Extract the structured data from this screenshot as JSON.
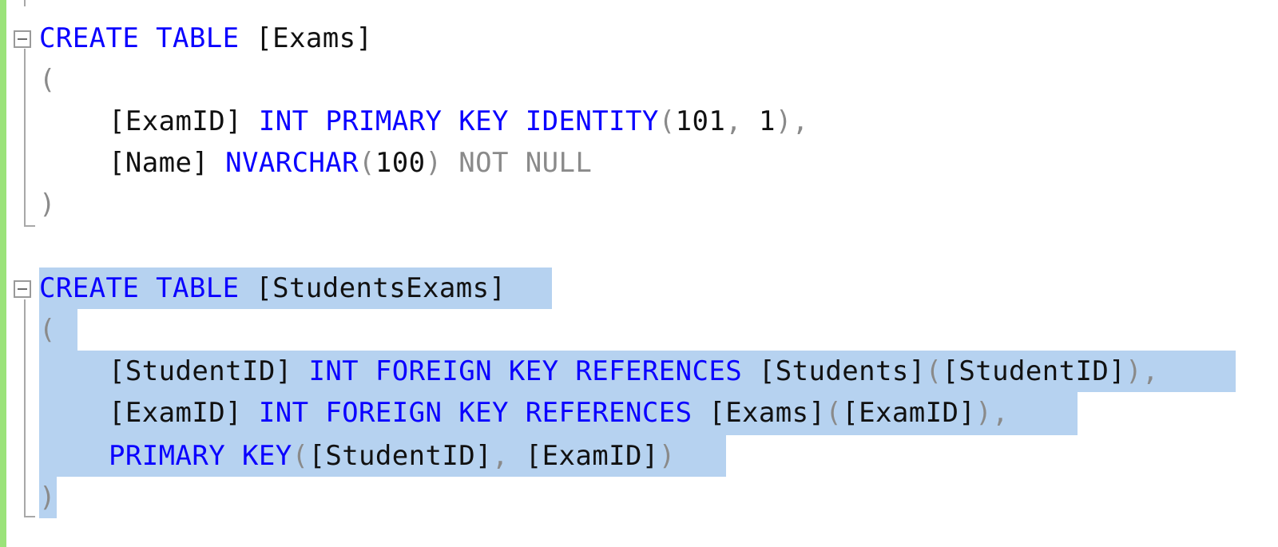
{
  "colors": {
    "keyword": "#0a00ff",
    "operator": "#8a8a8a",
    "text": "#111111",
    "selection": "#b6d2f0",
    "change_bar": "#9be37a"
  },
  "icons": {
    "fold": "collapse-minus-icon"
  },
  "code": {
    "l1": {
      "t1": "CREATE TABLE",
      "t2": " [Exams]"
    },
    "l2": {
      "t1": "("
    },
    "l3": {
      "t1": "[ExamID]",
      "t2": " INT PRIMARY KEY IDENTITY",
      "t3": "(",
      "t4": "101",
      "t5": ", ",
      "t6": "1",
      "t7": "),"
    },
    "l4": {
      "t1": "[Name]",
      "t2": " NVARCHAR",
      "t3": "(",
      "t4": "100",
      "t5": ") NOT NULL"
    },
    "l5": {
      "t1": ")"
    },
    "l6": {
      "t1": "CREATE TABLE",
      "t2": " [StudentsExams]"
    },
    "l7": {
      "t1": "("
    },
    "l8": {
      "t1": "[StudentID]",
      "t2": " INT FOREIGN KEY REFERENCES",
      "t3": " [Students]",
      "t4": "(",
      "t5": "[StudentID]",
      "t6": "),"
    },
    "l9": {
      "t1": "[ExamID]",
      "t2": " INT FOREIGN KEY REFERENCES",
      "t3": " [Exams]",
      "t4": "(",
      "t5": "[ExamID]",
      "t6": "),"
    },
    "l10": {
      "t1": "PRIMARY KEY",
      "t2": "(",
      "t3": "[StudentID]",
      "t4": ", ",
      "t5": "[ExamID]",
      "t6": ")"
    },
    "l11": {
      "t1": ")"
    }
  }
}
